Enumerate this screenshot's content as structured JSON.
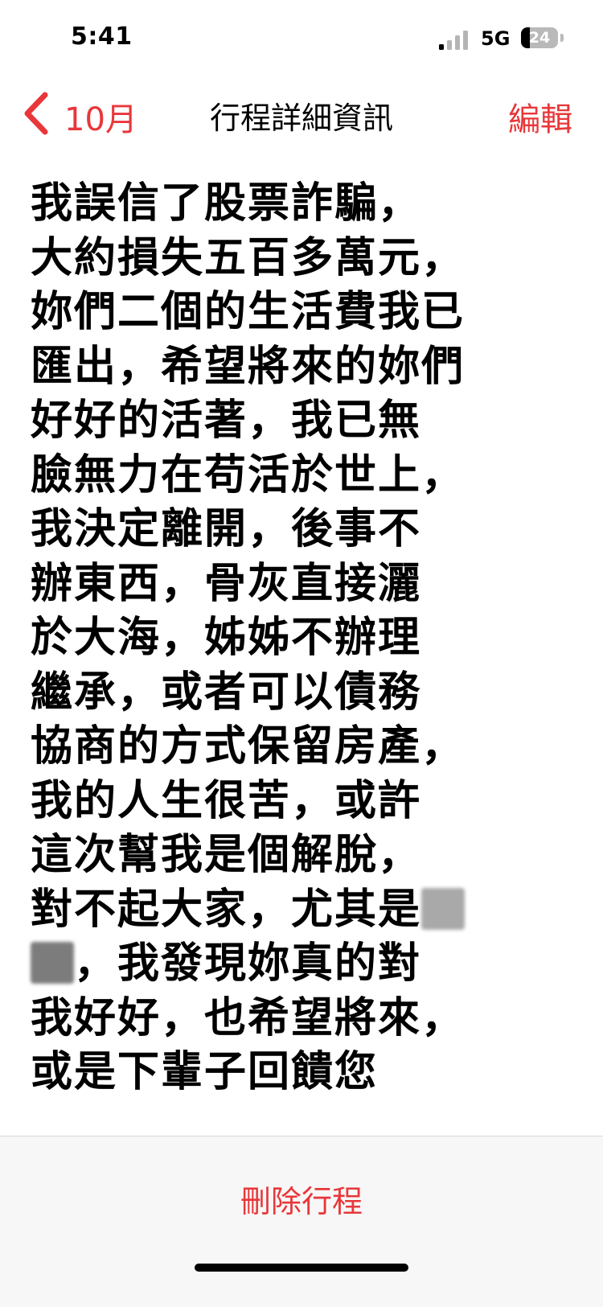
{
  "status_bar": {
    "time": "5:41",
    "network": "5G",
    "battery_level": "24"
  },
  "nav": {
    "back_label": "10月",
    "title": "行程詳細資訊",
    "edit_label": "編輯"
  },
  "note": {
    "lines": [
      "我誤信了股票詐騙，",
      "大約損失五百多萬元，",
      "妳們二個的生活費我已",
      "匯出，希望將來的妳們",
      "好好的活著，我已無",
      "臉無力在苟活於世上，",
      "我決定離開，後事不",
      "辦東西，骨灰直接灑",
      "於大海，姊姊不辦理",
      "繼承，或者可以債務",
      "協商的方式保留房產，",
      "我的人生很苦，或許",
      "這次幫我是個解脫，",
      "對不起大家，尤其是",
      "，我發現妳真的對",
      "我好好，也希望將來，",
      "或是下輩子回饋您"
    ]
  },
  "actions": {
    "delete_label": "刪除行程"
  },
  "colors": {
    "accent": "#e8373a",
    "text": "#000000",
    "toolbar_bg": "#f7f7f7"
  },
  "icons": {
    "back": "chevron-left-icon",
    "signal": "cellular-signal-icon",
    "battery": "battery-icon"
  }
}
